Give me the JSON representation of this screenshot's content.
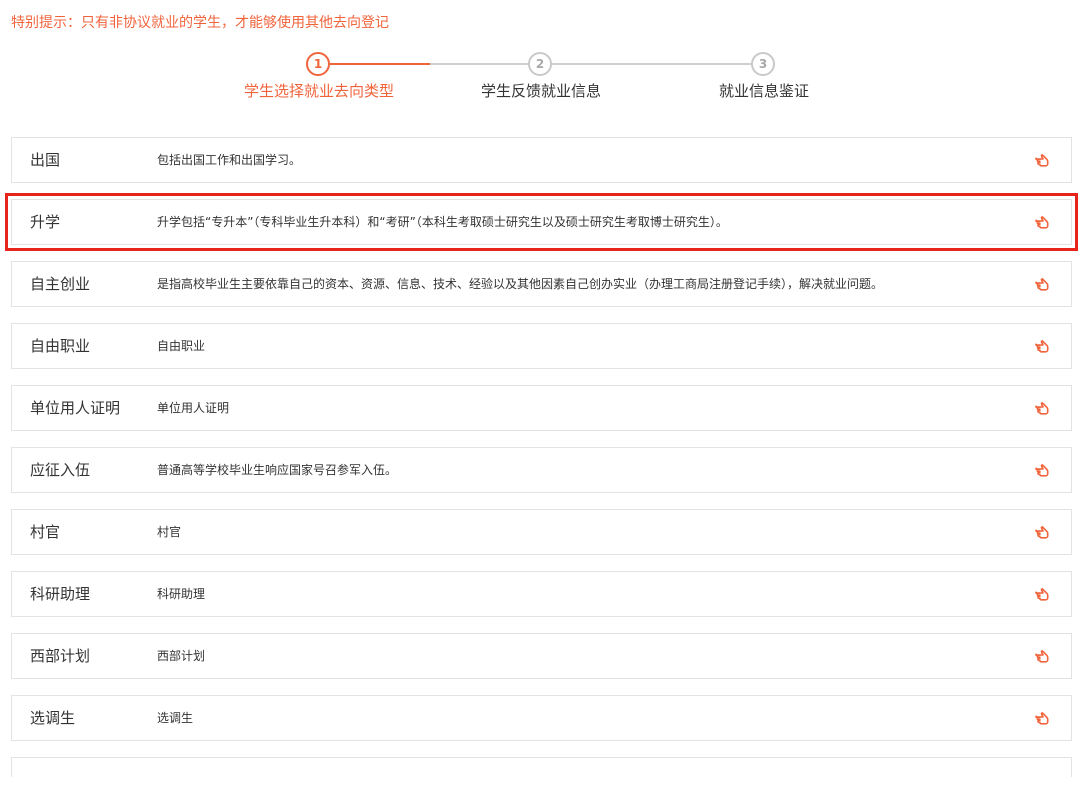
{
  "notice": "特别提示：只有非协议就业的学生，才能够使用其他去向登记",
  "steps": [
    {
      "number": "1",
      "label": "学生选择就业去向类型"
    },
    {
      "number": "2",
      "label": "学生反馈就业信息"
    },
    {
      "number": "3",
      "label": "就业信息鉴证"
    }
  ],
  "rows": [
    {
      "title": "出国",
      "desc": "包括出国工作和出国学习。"
    },
    {
      "title": "升学",
      "desc": "升学包括“专升本”（专科毕业生升本科）和“考研”（本科生考取硕士研究生以及硕士研究生考取博士研究生）。"
    },
    {
      "title": "自主创业",
      "desc": "是指高校毕业生主要依靠自己的资本、资源、信息、技术、经验以及其他因素自己创办实业（办理工商局注册登记手续），解决就业问题。"
    },
    {
      "title": "自由职业",
      "desc": "自由职业"
    },
    {
      "title": "单位用人证明",
      "desc": "单位用人证明"
    },
    {
      "title": "应征入伍",
      "desc": "普通高等学校毕业生响应国家号召参军入伍。"
    },
    {
      "title": "村官",
      "desc": "村官"
    },
    {
      "title": "科研助理",
      "desc": "科研助理"
    },
    {
      "title": "西部计划",
      "desc": "西部计划"
    },
    {
      "title": "选调生",
      "desc": "选调生"
    }
  ],
  "colors": {
    "accent": "#f0643c",
    "highlight": "#e8231a"
  },
  "row_icon": "pointing-hand-icon"
}
